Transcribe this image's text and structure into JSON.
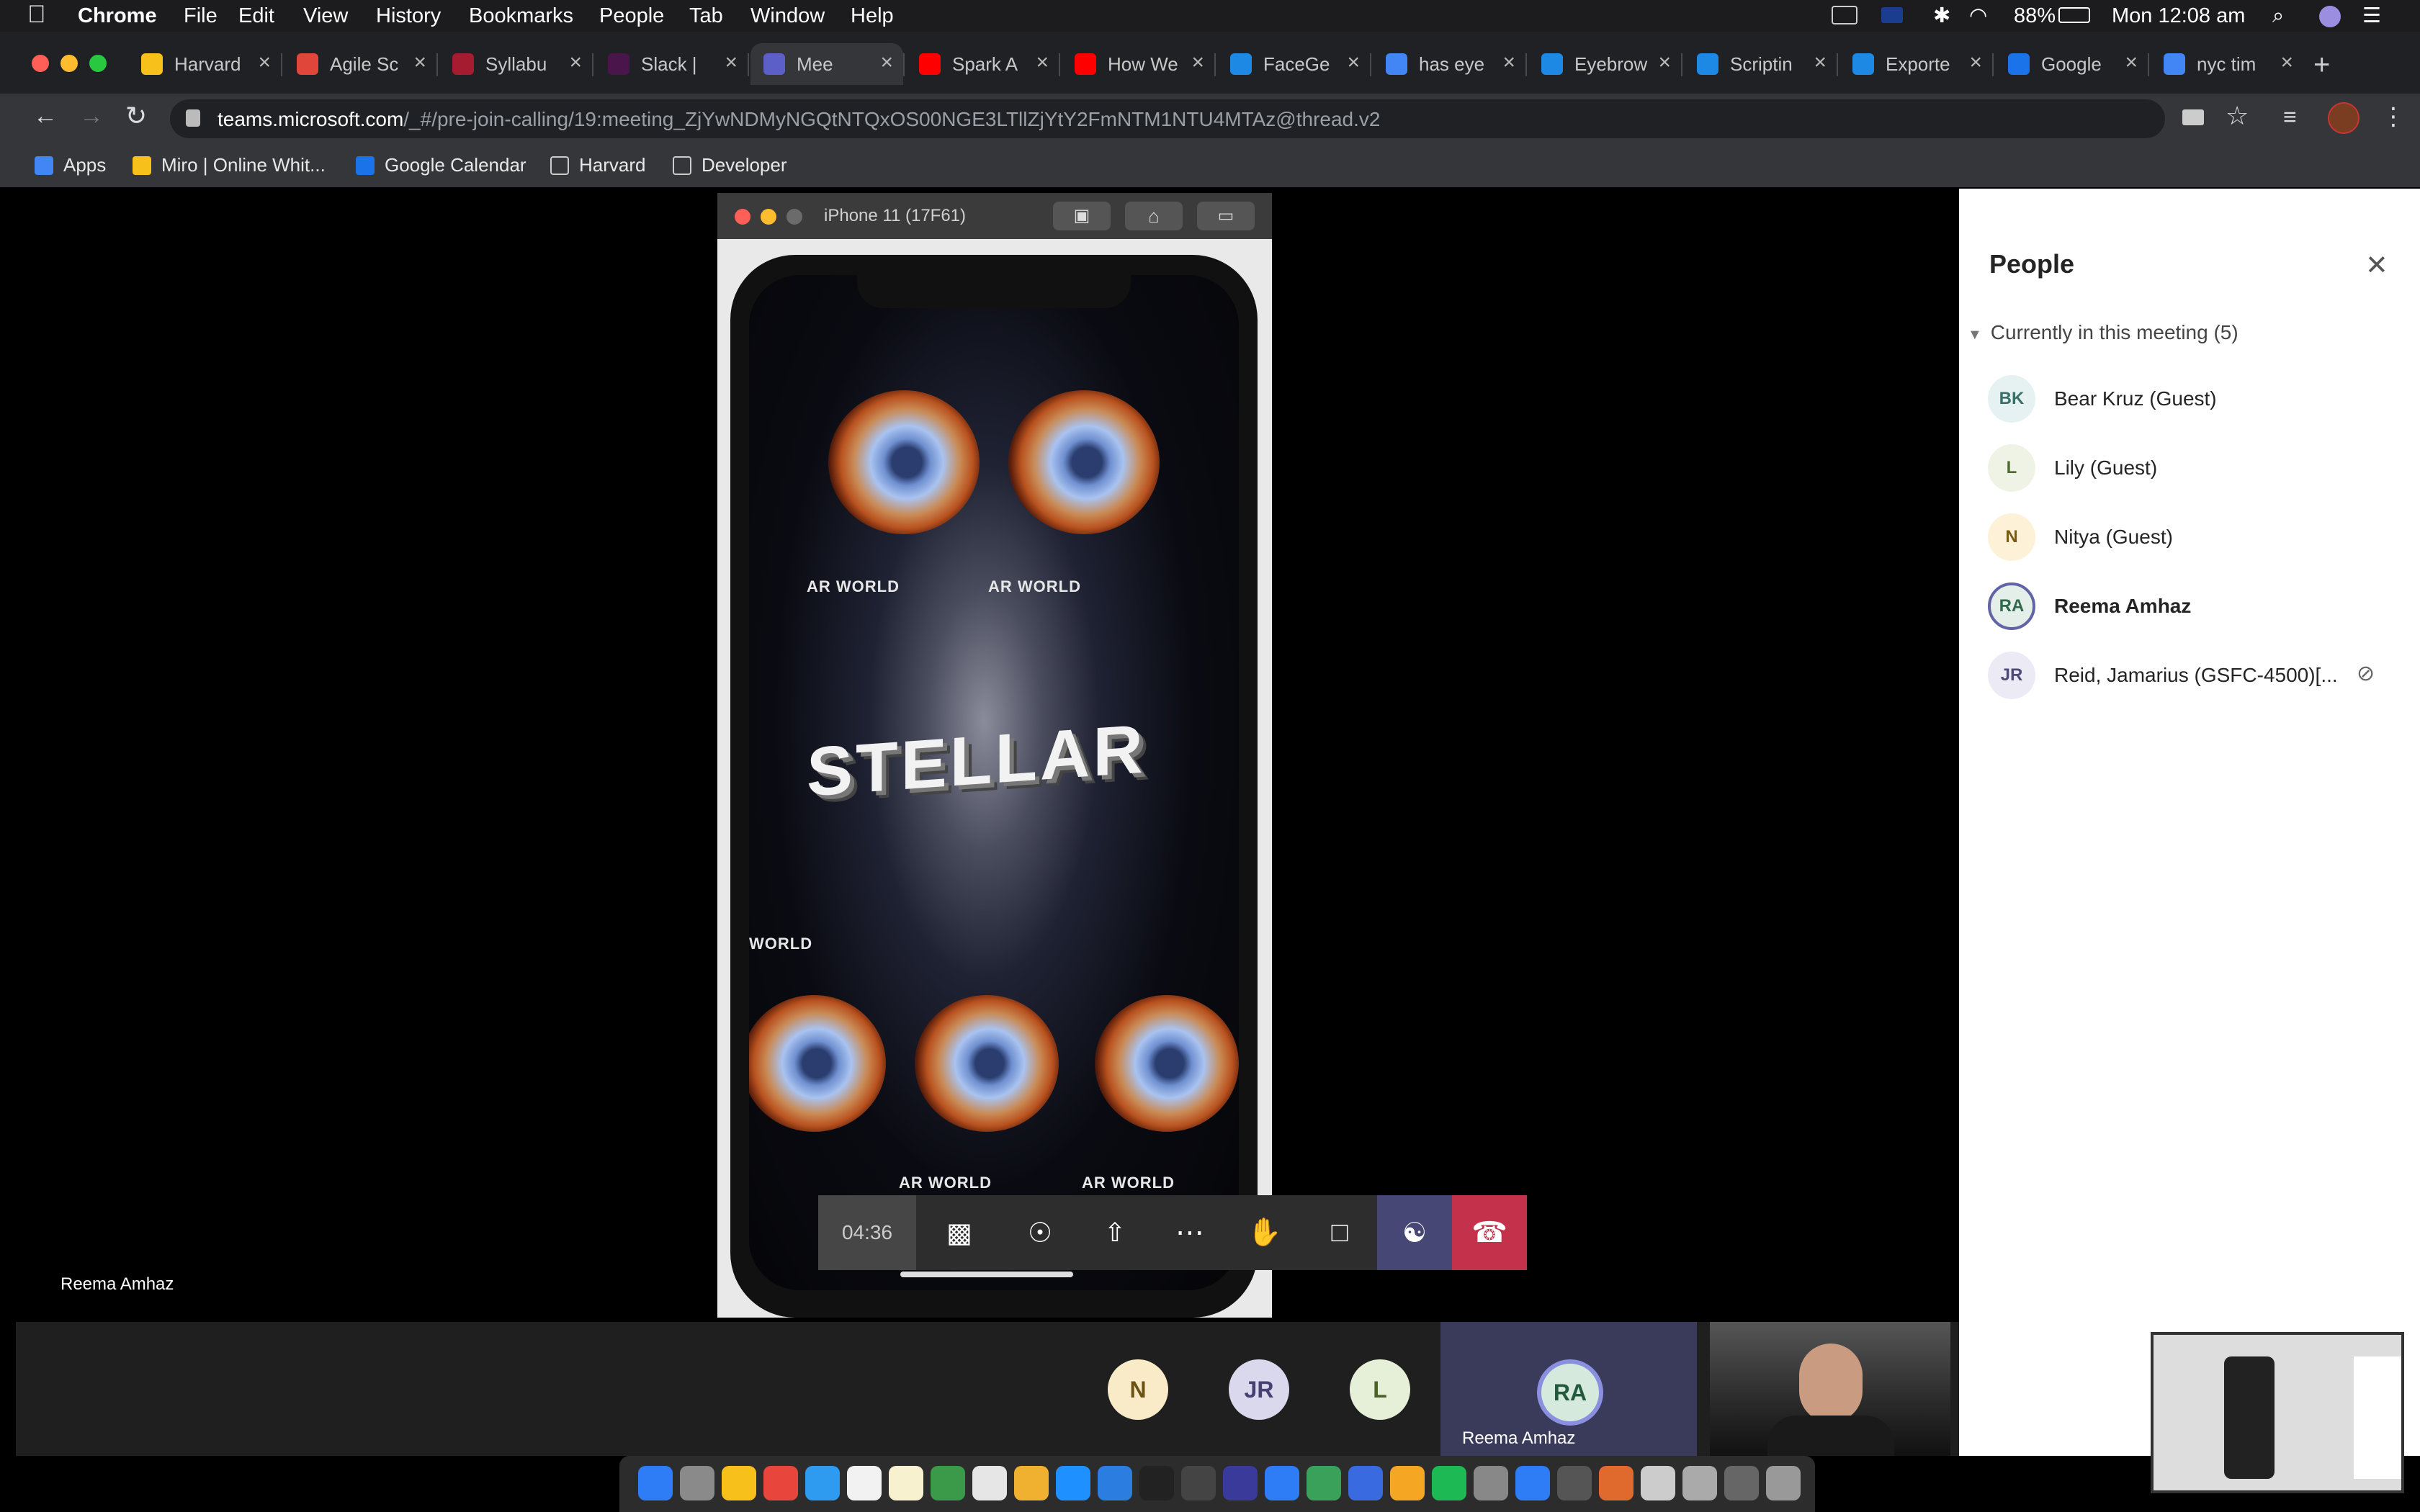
{
  "menubar": {
    "app": "Chrome",
    "items": [
      "File",
      "Edit",
      "View",
      "History",
      "Bookmarks",
      "People",
      "Tab",
      "Window",
      "Help"
    ],
    "battery": "88%",
    "clock": "Mon 12:08 am"
  },
  "tabs": [
    {
      "label": "Harvard",
      "color": "#f7c01b"
    },
    {
      "label": "Agile Sc",
      "color": "#e0473a"
    },
    {
      "label": "Syllabu",
      "color": "#a51c30"
    },
    {
      "label": "Slack |",
      "color": "#4a154b"
    },
    {
      "label": "Mee",
      "color": "#5b5fc7"
    },
    {
      "label": "Spark A",
      "color": "#ff0000"
    },
    {
      "label": "How We",
      "color": "#ff0000"
    },
    {
      "label": "FaceGe",
      "color": "#1e88e5"
    },
    {
      "label": "has eye",
      "color": "#4285f4"
    },
    {
      "label": "Eyebrow",
      "color": "#1e88e5"
    },
    {
      "label": "Scriptin",
      "color": "#1e88e5"
    },
    {
      "label": "Exporte",
      "color": "#1e88e5"
    },
    {
      "label": "Google",
      "color": "#1a73e8"
    },
    {
      "label": "nyc tim",
      "color": "#4285f4"
    }
  ],
  "address": {
    "domain": "teams.microsoft.com",
    "path": "/_#/pre-join-calling/19:meeting_ZjYwNDMyNGQtNTQxOS00NGE3LTllZjYtY2FmNTM1NTU4MTAz@thread.v2"
  },
  "bookmarks": [
    {
      "label": "Apps",
      "color": "#4285f4"
    },
    {
      "label": "Miro | Online Whit...",
      "color": "#f7c01b"
    },
    {
      "label": "Google Calendar",
      "color": "#1a73e8"
    },
    {
      "label": "Harvard",
      "color": "#9aa0a6"
    },
    {
      "label": "Developer",
      "color": "#9aa0a6"
    }
  ],
  "simulator": {
    "title": "iPhone 11 (17F61)",
    "app_title": "STELLAR",
    "ar_labels": [
      "AR WORLD",
      "AR WORLD",
      "WORLD",
      "AR WORLD",
      "AR WORLD"
    ]
  },
  "call": {
    "timer": "04:36",
    "presenter": "Reema Amhaz",
    "hangup_color": "#c4314b"
  },
  "people_panel": {
    "title": "People",
    "section": "Currently in this meeting",
    "count": "(5)",
    "participants": [
      {
        "initials": "BK",
        "name": "Bear Kruz (Guest)",
        "bg": "#e6f2f1",
        "fg": "#3a6f6a"
      },
      {
        "initials": "L",
        "name": "Lily (Guest)",
        "bg": "#eef3e6",
        "fg": "#50692f"
      },
      {
        "initials": "N",
        "name": "Nitya (Guest)",
        "bg": "#fdf1d8",
        "fg": "#7a5a15"
      },
      {
        "initials": "RA",
        "name": "Reema Amhaz",
        "bg": "#e3efe8",
        "fg": "#2f6a4b"
      },
      {
        "initials": "JR",
        "name": "Reid, Jamarius (GSFC-4500)[...",
        "bg": "#ecebf5",
        "fg": "#4f4a7a"
      }
    ]
  },
  "gallery": [
    {
      "initials": "N",
      "bg": "#f9ebc8",
      "fg": "#6d5114"
    },
    {
      "initials": "JR",
      "bg": "#d9d8ec",
      "fg": "#453f72"
    },
    {
      "initials": "L",
      "bg": "#e6efd8",
      "fg": "#4a6228"
    },
    {
      "initials": "RA",
      "name": "Reema Amhaz",
      "bg": "#d6e9dd",
      "fg": "#245a3c"
    }
  ]
}
